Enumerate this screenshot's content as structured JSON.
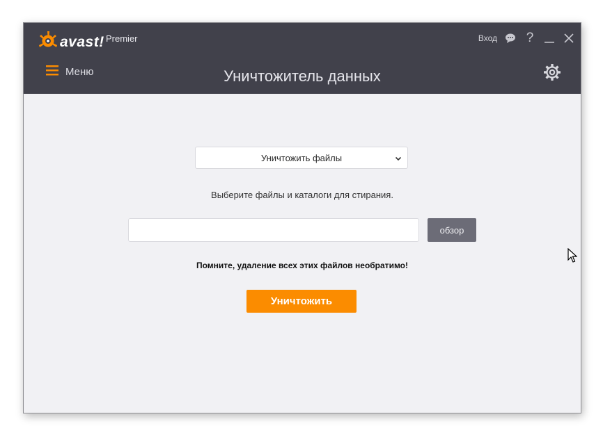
{
  "app": {
    "logo_text": "avast!",
    "edition": "Premier",
    "login_label": "Вход",
    "help_label": "?"
  },
  "header": {
    "menu_label": "Меню",
    "page_title": "Уничтожитель данных"
  },
  "main": {
    "mode_select": {
      "selected": "Уничтожить файлы"
    },
    "hint": "Выберите файлы и каталоги для стирания.",
    "path_input": {
      "value": "",
      "placeholder": ""
    },
    "browse_label": "обзор",
    "warning": "Помните, удаление всех этих файлов необратимо!",
    "shred_label": "Уничтожить"
  },
  "colors": {
    "header_bg": "#41414b",
    "body_bg": "#f1f1f4",
    "accent": "#fb8c00",
    "browse_bg": "#6c6c77"
  },
  "icons": [
    "avast-logo-icon",
    "chat-icon",
    "help-icon",
    "minimize-icon",
    "close-icon",
    "hamburger-icon",
    "gear-icon",
    "chevron-down-icon",
    "mouse-cursor-icon"
  ]
}
